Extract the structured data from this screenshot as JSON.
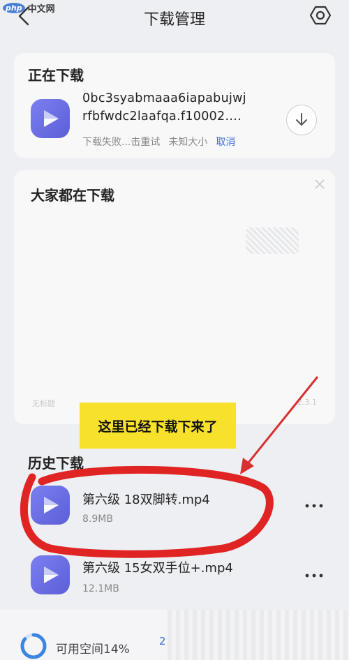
{
  "watermark": {
    "badge": "php",
    "text": "中文网"
  },
  "header": {
    "title": "下载管理"
  },
  "downloading": {
    "section_title": "正在下载",
    "file_line1": "0bc3syabmaaa6iapabujwj",
    "file_line2": "rfbfwdc2laafqa.f10002....",
    "status": "下载失败...击重试",
    "size": "未知大小",
    "cancel": "取消"
  },
  "popular": {
    "section_title": "大家都在下载",
    "faint_left": "无标题",
    "faint_right": "2.3.1"
  },
  "callout": {
    "text": "这里已经下载下来了"
  },
  "history": {
    "section_title": "历史下载",
    "items": [
      {
        "name": "第六级 18双脚转.mp4",
        "size": "8.9MB"
      },
      {
        "name": "第六级 15女双手位+.mp4",
        "size": "12.1MB"
      }
    ]
  },
  "storage": {
    "label": "可用空间14%",
    "used_fraction": 0.86,
    "extra": "2"
  },
  "colors": {
    "accent": "#3a6fd8",
    "icon": "#6a6ee6",
    "annotation": "#e02424",
    "callout": "#f7e12a"
  }
}
